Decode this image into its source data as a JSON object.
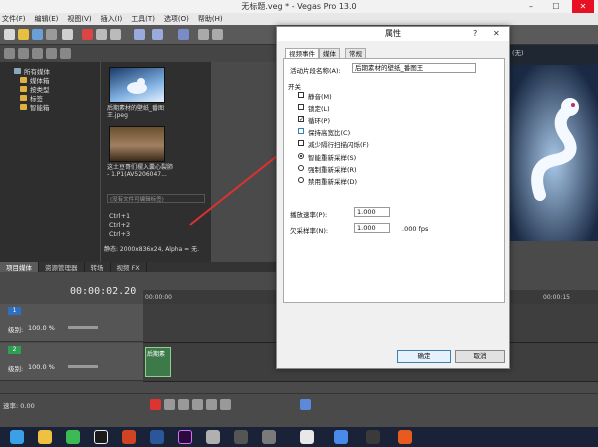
{
  "window": {
    "title": "无标题.veg * - Vegas Pro 13.0",
    "min": "–",
    "max": "☐",
    "close": "✕"
  },
  "menu": [
    "文件(F)",
    "编辑(E)",
    "视图(V)",
    "插入(I)",
    "工具(T)",
    "选项(O)",
    "帮助(H)"
  ],
  "explorer": {
    "tree": [
      "所有媒体",
      "媒体箱",
      "按类型",
      "标签",
      "智能箱"
    ],
    "media": [
      {
        "caption": "后期素材的壁纸_番图王.jpeg"
      },
      {
        "caption": "这土豆哥们摆入囊心裂肺 - 1.P1(AV5206047..."
      }
    ],
    "tag_placeholder": "(没有文件可编辑标签)",
    "shortcuts": [
      "Ctrl+1",
      "Ctrl+2",
      "Ctrl+3"
    ],
    "status": "静态: 2000x836x24, Alpha = 无."
  },
  "tabs": [
    "项目媒体",
    "资源管理器",
    "转场",
    "视频 FX"
  ],
  "timecode": "00:00:02.20",
  "ruler": [
    "00:00:00",
    "00:00:15"
  ],
  "tracks": [
    {
      "num": "1",
      "level_label": "级别:",
      "level": "100.0 %"
    },
    {
      "num": "2",
      "level_label": "级别:",
      "level": "100.0 %"
    }
  ],
  "clip_label": "后期素",
  "bottom": {
    "rate": "速率: 0.00"
  },
  "dialog": {
    "title": "属性",
    "help": "?",
    "close": "✕",
    "tabs": [
      "视频事件",
      "媒体",
      "常规"
    ],
    "active_name_label": "活动片段名称(A):",
    "active_name_value": "后期素材的壁纸_番图王",
    "switches_label": "开关",
    "checkboxes": [
      {
        "label": "静音(M)",
        "checked": false
      },
      {
        "label": "锁定(L)",
        "checked": false
      },
      {
        "label": "循环(P)",
        "checked": true
      },
      {
        "label": "保持高宽比(C)",
        "checked": false
      },
      {
        "label": "减少隔行扫描闪烁(F)",
        "checked": false
      }
    ],
    "radios": [
      {
        "label": "智能重新采样(S)",
        "selected": true
      },
      {
        "label": "强制重新采样(R)",
        "selected": false
      },
      {
        "label": "禁用重新采样(D)",
        "selected": false
      }
    ],
    "playback_rate_label": "播放速率(P):",
    "playback_rate_value": "1.000",
    "undersample_label": "欠采样率(N):",
    "undersample_value": "1.000",
    "undersample_unit": ".000 fps",
    "ok": "确定",
    "cancel": "取消"
  },
  "preview_combo": "(无)",
  "colors": {
    "accent_arrow": "#e03030",
    "ok_border": "#3c7fb1"
  }
}
